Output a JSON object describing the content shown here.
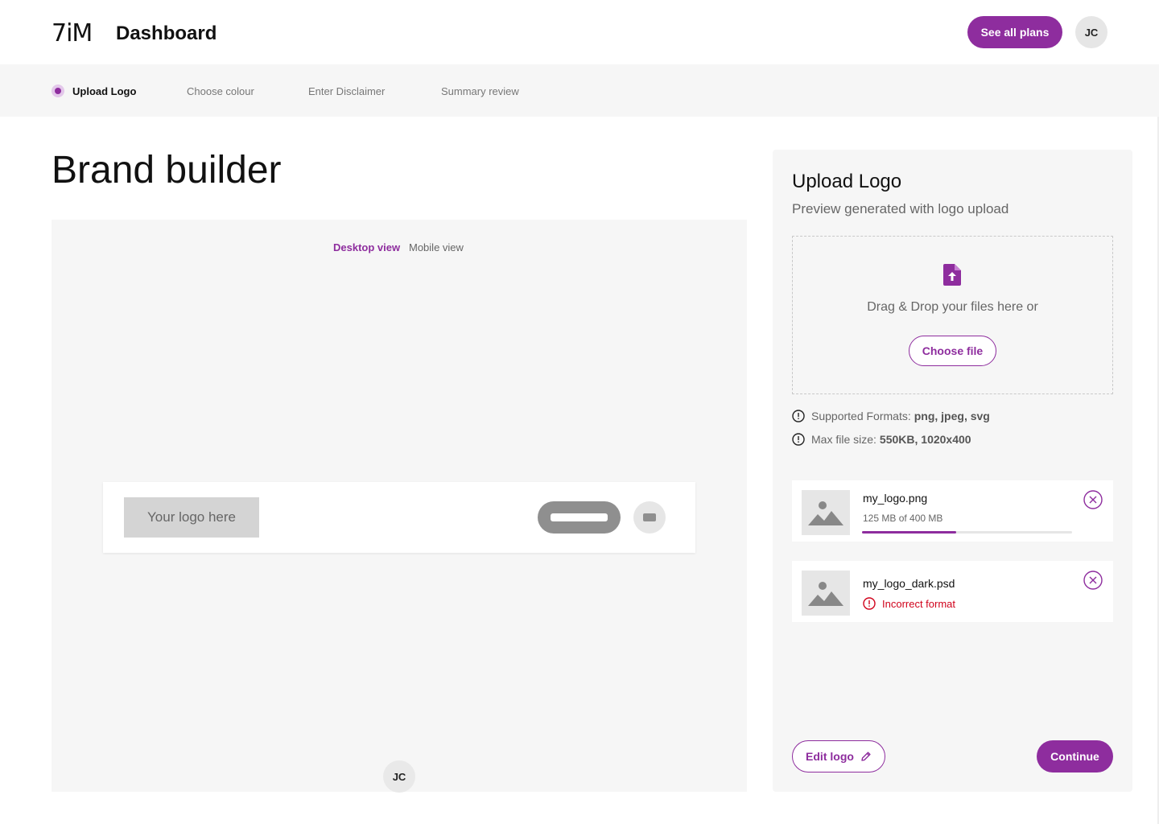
{
  "header": {
    "logo_text": "7iM",
    "title": "Dashboard",
    "plans_button": "See all plans",
    "user_initials": "JC"
  },
  "steps": [
    {
      "label": "Upload Logo",
      "active": true
    },
    {
      "label": "Choose colour",
      "active": false
    },
    {
      "label": "Enter Disclaimer",
      "active": false
    },
    {
      "label": "Summary review",
      "active": false
    }
  ],
  "main": {
    "title": "Brand builder",
    "view_tabs": [
      {
        "label": "Desktop view",
        "active": true
      },
      {
        "label": "Mobile view",
        "active": false
      }
    ],
    "mock_logo_text": "Your logo here",
    "preview_user_initials": "JC"
  },
  "panel": {
    "title": "Upload Logo",
    "subtitle": "Preview generated with logo upload",
    "drop_text": "Drag & Drop your files here or",
    "choose_button": "Choose file",
    "formats_label": "Supported Formats:",
    "formats_value": "png, jpeg, svg",
    "max_label": "Max file size:",
    "max_value": "550KB, 1020x400",
    "files": [
      {
        "name": "my_logo.png",
        "meta": "125 MB of 400 MB",
        "progress": 0.45,
        "status": "uploading"
      },
      {
        "name": "my_logo_dark.psd",
        "error": "Incorrect format",
        "status": "error"
      }
    ],
    "edit_button": "Edit logo",
    "continue_button": "Continue"
  },
  "colors": {
    "accent": "#8e2d9e",
    "error": "#d0021b",
    "panel_bg": "#f6f6f6"
  },
  "icons": [
    "file-upload-icon",
    "info-icon",
    "image-placeholder-icon",
    "close-circle-icon",
    "error-icon",
    "pencil-icon"
  ]
}
